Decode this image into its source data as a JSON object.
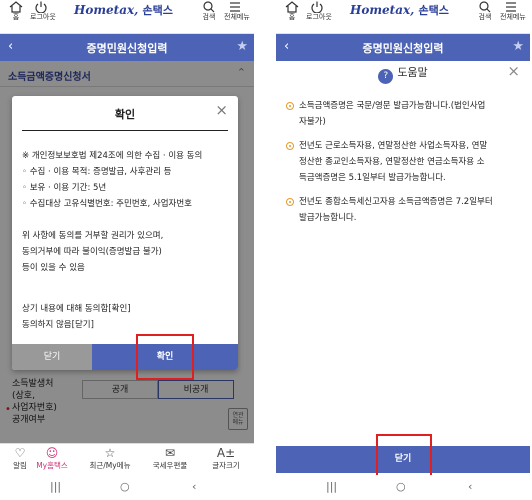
{
  "header": {
    "home_label": "홈",
    "logout_label": "로그아웃",
    "logo_text": "Hometax,",
    "logo_korean": "손택스",
    "search_label": "검색",
    "menu_label": "전체메뉴"
  },
  "titlebar": {
    "title": "증명민원신청입력"
  },
  "left": {
    "section_title": "소득금액증명신청서",
    "dialog": {
      "title": "확인",
      "lines": [
        "※ 개인정보보호법 제24조에 의한 수집 · 이용 동의",
        "◦ 수집 · 이용 목적: 증명발급, 사후관리 등",
        "◦ 보유 · 이용 기간: 5년",
        "◦ 수집대상 고유식별번호: 주민번호, 사업자번호"
      ],
      "notice_lines": [
        "위 사항에 동의를 거부할 권리가 있으며,",
        "동의거부에 따라 불이익(증명발급 불가)",
        "등이 있을 수 있음"
      ],
      "choice_lines": [
        "상기 내용에 대해 동의함[확인]",
        "동의하지 않음[닫기]"
      ],
      "cancel_label": "닫기",
      "ok_label": "확인"
    },
    "form": {
      "label_lines": [
        "소득발생처",
        "(상호,",
        "사업자번호)",
        "공개여부"
      ],
      "public_label": "공개",
      "private_label": "비공개",
      "help_label_1": "연관",
      "help_label_2": "메뉴"
    }
  },
  "tabbar": {
    "tabs": [
      {
        "label": "알림"
      },
      {
        "label": "My홈택스"
      },
      {
        "label": "최근/My메뉴"
      },
      {
        "label": "국세우편물"
      },
      {
        "label": "글자크기"
      }
    ]
  },
  "right": {
    "help_title": "도움말",
    "items": [
      {
        "lines": [
          "소득금액증명은 국문/영문 발급가능합니다.(법인사업",
          "자불가)"
        ]
      },
      {
        "lines": [
          "전년도 근로소득자용, 연말정산한 사업소득자용, 연말",
          "정산한 종교인소득자용, 연말정산한 연금소득자용 소",
          "득금액증명은 5.1일부터 발급가능합니다."
        ]
      },
      {
        "lines": [
          "전년도 종합소득세신고자용 소득금액증명은 7.2일부터",
          "발급가능합니다."
        ]
      }
    ],
    "close_label": "닫기"
  },
  "colors": {
    "primary": "#4c63b6",
    "highlight": "#e02020",
    "active_tab": "#d32f7a",
    "bullet": "#e89a2a"
  }
}
